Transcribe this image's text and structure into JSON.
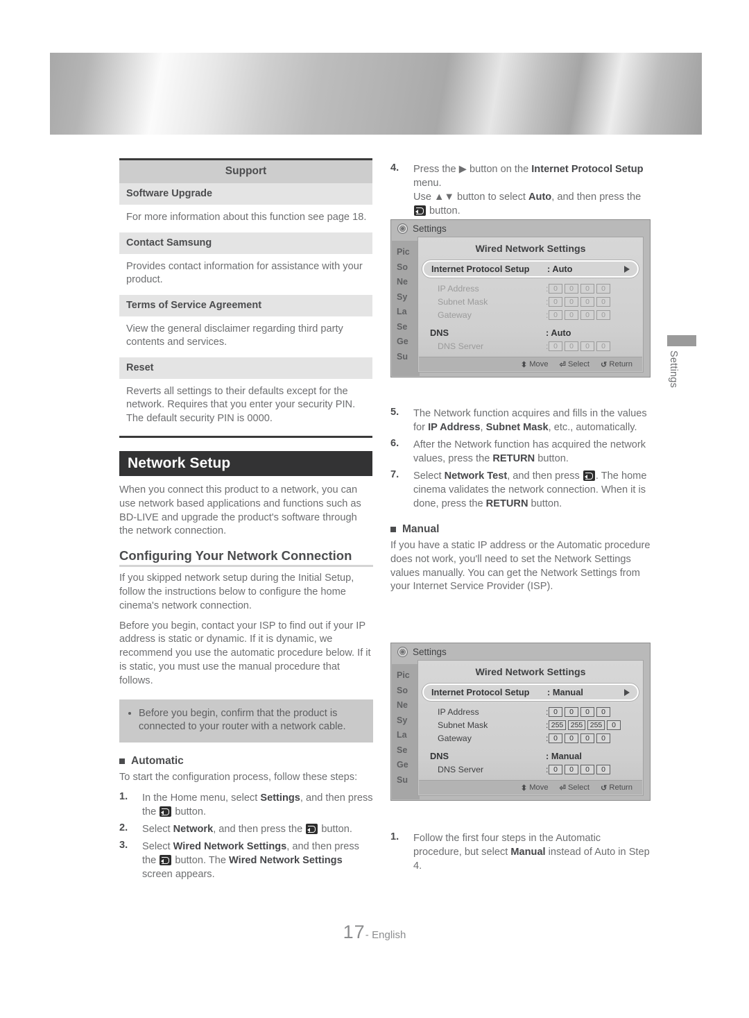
{
  "page": {
    "number": "17",
    "separator": "-",
    "language": "English"
  },
  "side_tab": {
    "label": "Settings"
  },
  "support_table": {
    "header": "Support",
    "rows": [
      {
        "title": "Software Upgrade",
        "body": "For more information about this function see page 18."
      },
      {
        "title": "Contact Samsung",
        "body": "Provides contact information for assistance with your product."
      },
      {
        "title": "Terms of Service Agreement",
        "body": "View the general disclaimer regarding third party contents and services."
      },
      {
        "title": "Reset",
        "body": "Reverts all settings to their defaults except for the network. Requires that you enter your security PIN. The default security PIN is 0000."
      }
    ]
  },
  "network_setup": {
    "section_title": "Network Setup",
    "intro": "When you connect this product to a network, you can use network based applications and functions such as BD-LIVE and upgrade the product's software through the network connection.",
    "subsection_title": "Configuring Your Network Connection",
    "paragraph1": "If you skipped network setup during the Initial Setup, follow the instructions below to configure the home cinema's network connection.",
    "paragraph2": "Before you begin, contact your ISP to find out if your IP address is static or dynamic. If it is dynamic, we recommend you use the automatic procedure below. If it is static, you must use the manual procedure that follows.",
    "note": "Before you begin, confirm that the product is connected to your router with a network cable."
  },
  "automatic": {
    "heading": "Automatic",
    "lead": "To start the configuration process, follow these steps:",
    "steps": [
      {
        "num": "1.",
        "text_html": "In the Home menu, select <b class=\"kw\">Settings</b>, and then press the <span class=\"ent\"></span> button."
      },
      {
        "num": "2.",
        "text_html": "Select <b class=\"kw\">Network</b>, and then press the <span class=\"ent\"></span> button."
      },
      {
        "num": "3.",
        "text_html": "Select <b class=\"kw\">Wired Network Settings</b>, and then press the <span class=\"ent\"></span> button. The <b class=\"kw\">Wired Network Settings</b> screen appears."
      },
      {
        "num": "4.",
        "text_html": "Press the ▶ button on the <b class=\"kw\">Internet Protocol Setup</b> menu.<br>Use ▲▼ button to select <b class=\"kw\">Auto</b>, and then press the <span class=\"ent\"></span> button."
      },
      {
        "num": "5.",
        "text_html": "The Network function acquires and fills in the values for <b class=\"kw\">IP Address</b>, <b class=\"kw\">Subnet Mask</b>, etc., automatically."
      },
      {
        "num": "6.",
        "text_html": "After the Network function has acquired the network values, press the <b class=\"kw\">RETURN</b> button."
      },
      {
        "num": "7.",
        "text_html": "Select <b class=\"kw\">Network Test</b>, and then press <span class=\"ent\"></span>. The home cinema validates the network connection. When it is done, press the <b class=\"kw\">RETURN</b> button."
      }
    ]
  },
  "manual": {
    "heading": "Manual",
    "lead": "If you have a static IP address or the Automatic procedure does not work, you'll need to set the Network Settings values manually. You can get the Network Settings from your Internet Service Provider (ISP).",
    "steps": [
      {
        "num": "1.",
        "text_html": "Follow the first four steps in the Automatic procedure, but select <b class=\"kw\">Manual</b> instead of Auto in Step 4."
      }
    ]
  },
  "tv_screens": [
    {
      "window_title": "Settings",
      "panel_title": "Wired Network Settings",
      "sidebar_items": [
        "Pic",
        "So",
        "Ne",
        "Sy",
        "La",
        "Se",
        "Ge",
        "Su"
      ],
      "highlight_row": {
        "label": "Internet Protocol Setup",
        "value": ": Auto"
      },
      "rows": [
        {
          "label": "IP Address",
          "colon": ":",
          "octets": [
            "0",
            "0",
            "0",
            "0"
          ],
          "enabled": false
        },
        {
          "label": "Subnet Mask",
          "colon": ":",
          "octets": [
            "0",
            "0",
            "0",
            "0"
          ],
          "enabled": false
        },
        {
          "label": "Gateway",
          "colon": ":",
          "octets": [
            "0",
            "0",
            "0",
            "0"
          ],
          "enabled": false
        }
      ],
      "dns_row": {
        "label": "DNS",
        "value": ": Auto"
      },
      "dns_server_row": {
        "label": "DNS Server",
        "colon": ":",
        "octets": [
          "0",
          "0",
          "0",
          "0"
        ],
        "enabled": false
      },
      "footer": {
        "move": "Move",
        "select": "Select",
        "return": "Return"
      }
    },
    {
      "window_title": "Settings",
      "panel_title": "Wired Network Settings",
      "sidebar_items": [
        "Pic",
        "So",
        "Ne",
        "Sy",
        "La",
        "Se",
        "Ge",
        "Su"
      ],
      "highlight_row": {
        "label": "Internet Protocol Setup",
        "value": ": Manual"
      },
      "rows": [
        {
          "label": "IP Address",
          "colon": ":",
          "octets": [
            "0",
            "0",
            "0",
            "0"
          ],
          "enabled": true
        },
        {
          "label": "Subnet Mask",
          "colon": ":",
          "octets": [
            "255",
            "255",
            "255",
            "0"
          ],
          "enabled": true
        },
        {
          "label": "Gateway",
          "colon": ":",
          "octets": [
            "0",
            "0",
            "0",
            "0"
          ],
          "enabled": true
        }
      ],
      "dns_row": {
        "label": "DNS",
        "value": ": Manual"
      },
      "dns_server_row": {
        "label": "DNS Server",
        "colon": ":",
        "octets": [
          "0",
          "0",
          "0",
          "0"
        ],
        "enabled": true
      },
      "footer": {
        "move": "Move",
        "select": "Select",
        "return": "Return"
      }
    }
  ]
}
